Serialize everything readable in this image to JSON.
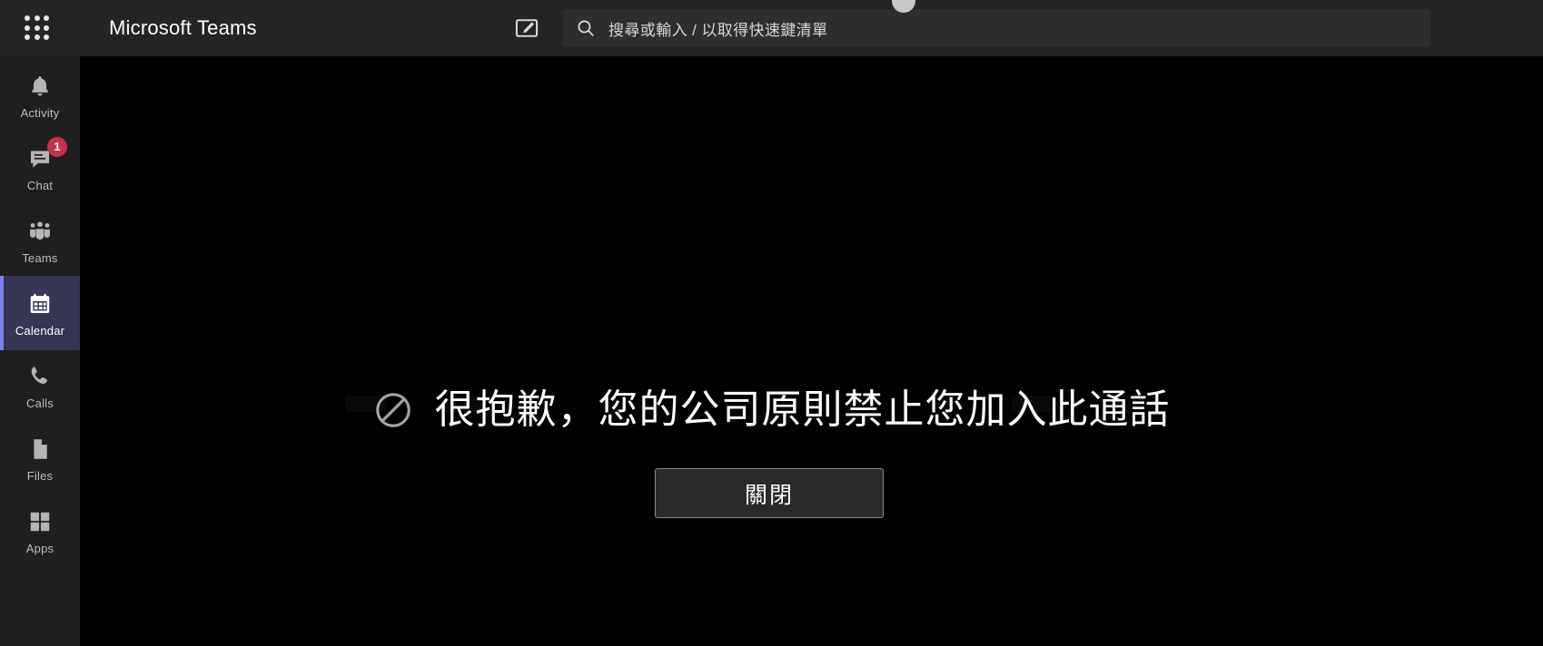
{
  "window": {
    "app_title": "Microsoft Teams",
    "background": "#201f1f",
    "stage_background": "#000000",
    "accent": "#7b83eb",
    "badge_color": "#c4314b"
  },
  "topbar": {
    "waffle_icon": "app-launcher-grid-icon",
    "compose_icon": "compose-new-icon",
    "search": {
      "icon": "search-icon",
      "placeholder": "搜尋或輸入 / 以取得快速鍵清單",
      "value": ""
    },
    "avatar": "user-avatar"
  },
  "rail": {
    "items": [
      {
        "key": "activity",
        "label": "Activity",
        "icon": "bell-icon",
        "active": false,
        "badge": ""
      },
      {
        "key": "chat",
        "label": "Chat",
        "icon": "chat-icon",
        "active": false,
        "badge": "1"
      },
      {
        "key": "teams",
        "label": "Teams",
        "icon": "teams-icon",
        "active": false,
        "badge": ""
      },
      {
        "key": "calendar",
        "label": "Calendar",
        "icon": "calendar-icon",
        "active": true,
        "badge": ""
      },
      {
        "key": "calls",
        "label": "Calls",
        "icon": "phone-icon",
        "active": false,
        "badge": ""
      },
      {
        "key": "files",
        "label": "Files",
        "icon": "file-icon",
        "active": false,
        "badge": ""
      },
      {
        "key": "apps",
        "label": "Apps",
        "icon": "apps-grid-icon",
        "active": false,
        "badge": ""
      }
    ]
  },
  "stage": {
    "notice": {
      "icon": "block-prohibited-icon",
      "message": "很抱歉，您的公司原則禁止您加入此通話"
    },
    "close_button": {
      "label": "關閉"
    }
  }
}
